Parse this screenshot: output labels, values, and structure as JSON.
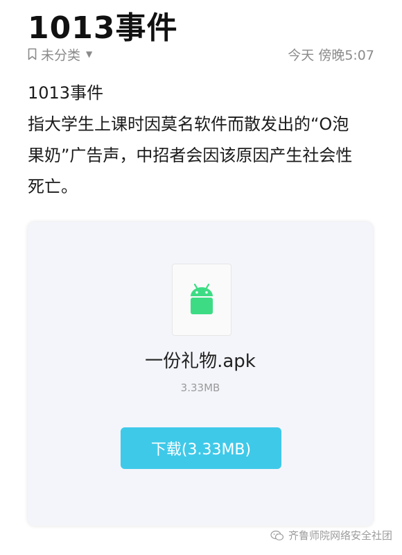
{
  "note": {
    "title": "1013事件",
    "category": "未分类",
    "timestamp": "今天 傍晚5:07",
    "body_lines": [
      "1013事件",
      "指大学生上课时因莫名软件而散发出的“O泡",
      "果奶”广告声，中招者会因该原因产生社会性",
      "死亡。"
    ]
  },
  "attachment": {
    "icon": "android-icon",
    "file_name": "一份礼物.apk",
    "file_size": "3.33MB",
    "download_label": "下载(3.33MB)"
  },
  "watermark": {
    "text": "齐鲁师院网络安全社团",
    "icon": "wechat-icon"
  },
  "colors": {
    "android_green": "#3ddc84",
    "download_button": "#3fc9e9",
    "meta_text": "#8a8a8a"
  }
}
